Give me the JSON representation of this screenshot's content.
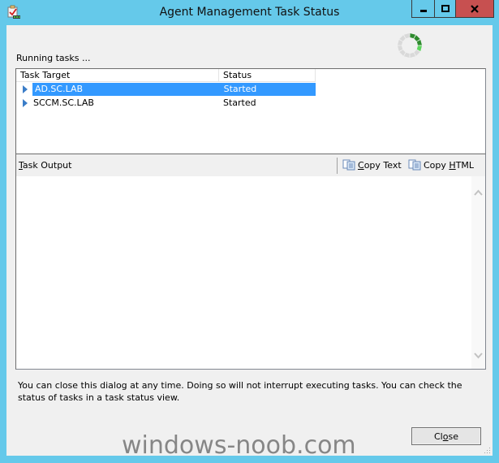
{
  "window": {
    "title": "Agent Management Task Status",
    "icon": "task-clipboard-icon",
    "controls": {
      "minimize": "minimize-icon",
      "maximize": "maximize-icon",
      "close": "close-icon"
    }
  },
  "status": {
    "running_label": "Running tasks ...",
    "spinner": "busy-spinner-icon"
  },
  "task_list": {
    "columns": [
      "Task Target",
      "Status"
    ],
    "rows": [
      {
        "target": "AD.SC.LAB",
        "status": "Started",
        "selected": true
      },
      {
        "target": "SCCM.SC.LAB",
        "status": "Started",
        "selected": false
      }
    ]
  },
  "output": {
    "title_access_key": "T",
    "title_rest": "ask Output",
    "copy_text": {
      "pre": "",
      "key": "C",
      "post": "opy Text",
      "icon": "copy-icon"
    },
    "copy_html": {
      "pre": "Copy ",
      "key": "H",
      "post": "TML",
      "icon": "copy-icon"
    },
    "content": ""
  },
  "info_text": "You can close this dialog at any time. Doing so will not interrupt executing tasks. You can check the status of tasks in a task status view.",
  "close_button": {
    "pre": "Cl",
    "key": "o",
    "post": "se"
  },
  "watermark": "windows-noob.com",
  "colors": {
    "frame": "#65c9ea",
    "close_hover": "#c75050",
    "selection": "#3399ff",
    "spinner_active": "#2e8b2e",
    "spinner_inactive": "#d9d9d9"
  }
}
